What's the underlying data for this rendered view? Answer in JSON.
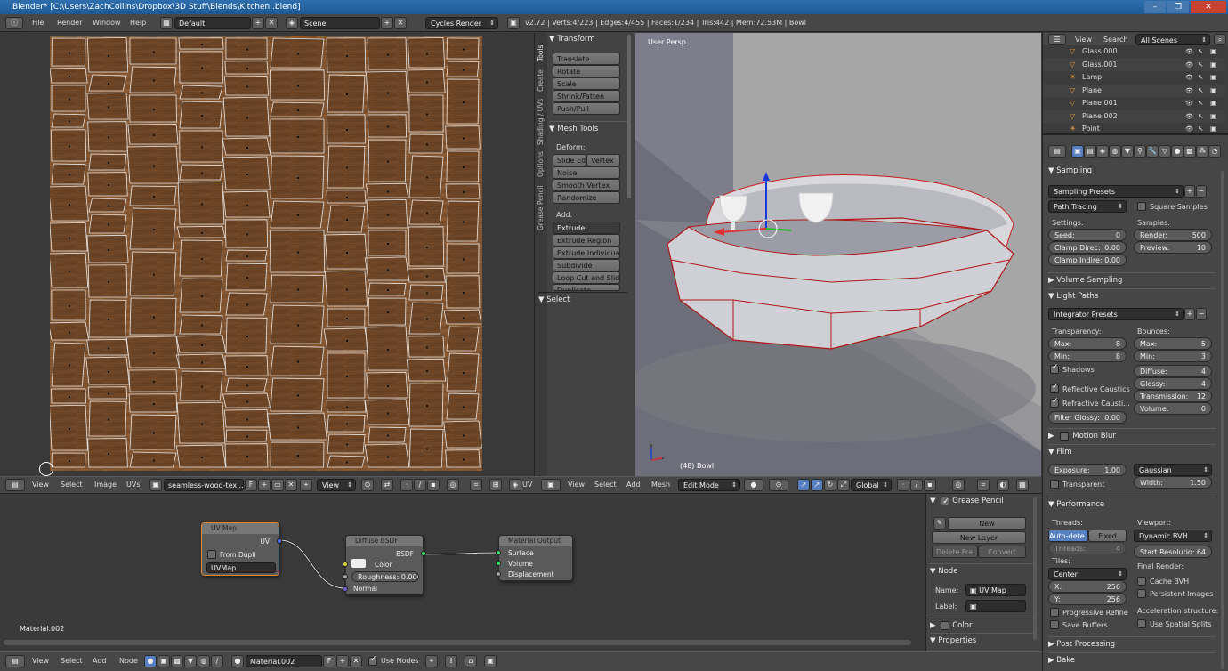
{
  "window": {
    "title": "Blender* [C:\\Users\\ZachCollins\\Dropbox\\3D Stuff\\Blends\\Kitchen .blend]"
  },
  "topbar": {
    "menu": [
      "File",
      "Render",
      "Window",
      "Help"
    ],
    "layout": "Default",
    "scene": "Scene",
    "engine": "Cycles Render",
    "stats": "v2.72 | Verts:4/223 | Edges:4/455 | Faces:1/234 | Tris:442 | Mem:72.53M | Bowl"
  },
  "uv_editor": {
    "header": {
      "view": "View",
      "select": "Select",
      "image": "Image",
      "uvs": "UVs",
      "image_name": "seamless-wood-tex...",
      "fake": "F",
      "view2": "View",
      "uv_label": "UV"
    }
  },
  "tool_shelf": {
    "tabs": [
      "Tools",
      "Create",
      "Shading / UVs",
      "Options",
      "Grease Pencil"
    ],
    "transform_title": "Transform",
    "transform": [
      "Translate",
      "Rotate",
      "Scale",
      "Shrink/Fatten",
      "Push/Pull"
    ],
    "mesh_tools_title": "Mesh Tools",
    "deform_label": "Deform:",
    "slide_edge": "Slide Ed",
    "vertex": "Vertex",
    "noise": "Noise",
    "smooth_vertex": "Smooth Vertex",
    "randomize": "Randomize",
    "add_label": "Add:",
    "extrude": "Extrude",
    "add": [
      "Extrude Region",
      "Extrude Individual",
      "Subdivide",
      "Loop Cut and Slide",
      "Duplicate"
    ],
    "select_title": "Select"
  },
  "viewport": {
    "label": "User Persp",
    "object_label": "(48) Bowl",
    "header": {
      "view": "View",
      "select": "Select",
      "add": "Add",
      "mesh": "Mesh",
      "mode": "Edit Mode",
      "orientation": "Global"
    }
  },
  "outliner": {
    "header": {
      "view": "View",
      "search": "Search",
      "scenes": "All Scenes"
    },
    "items": [
      "Glass.000",
      "Glass.001",
      "Lamp",
      "Plane",
      "Plane.001",
      "Plane.002",
      "Point"
    ]
  },
  "properties": {
    "sampling": {
      "title": "Sampling",
      "presets": "Sampling Presets",
      "integrator": "Path Tracing",
      "square_samples": "Square Samples",
      "settings_label": "Settings:",
      "samples_label": "Samples:",
      "seed_label": "Seed:",
      "seed": "0",
      "render_label": "Render:",
      "render": "500",
      "clamp_direct_label": "Clamp Direc:",
      "clamp_direct": "0.00",
      "preview_label": "Preview:",
      "preview": "10",
      "clamp_indirect_label": "Clamp Indire:",
      "clamp_indirect": "0.00"
    },
    "volume_sampling": "Volume Sampling",
    "light_paths": {
      "title": "Light Paths",
      "presets": "Integrator Presets",
      "transparency_label": "Transparency:",
      "bounces_label": "Bounces:",
      "t_max_label": "Max:",
      "t_max": "8",
      "t_min_label": "Min:",
      "t_min": "8",
      "b_max_label": "Max:",
      "b_max": "5",
      "b_min_label": "Min:",
      "b_min": "3",
      "shadows": "Shadows",
      "diffuse_label": "Diffuse:",
      "diffuse": "4",
      "glossy_label": "Glossy:",
      "glossy": "4",
      "reflective": "Reflective Caustics",
      "transmission_label": "Transmission:",
      "transmission": "12",
      "refractive": "Refractive Causti...",
      "volume_label": "Volume:",
      "volume": "0",
      "filter_glossy_label": "Filter Glossy:",
      "filter_glossy": "0.00"
    },
    "motion_blur": "Motion Blur",
    "film": {
      "title": "Film",
      "exposure_label": "Exposure:",
      "exposure": "1.00",
      "filter": "Gaussian",
      "transparent": "Transparent",
      "width_label": "Width:",
      "width": "1.50"
    },
    "performance": {
      "title": "Performance",
      "threads_label": "Threads:",
      "viewport_label": "Viewport:",
      "auto_detect": "Auto-dete...",
      "fixed": "Fixed",
      "viewport_bvh": "Dynamic BVH",
      "threads_field_label": "Threads:",
      "threads": "4",
      "start_res_label": "Start Resolutio:",
      "start_res": "64",
      "tiles_label": "Tiles:",
      "final_render_label": "Final Render:",
      "tile_order": "Center",
      "cache_bvh": "Cache BVH",
      "x_label": "X:",
      "x": "256",
      "persistent_images": "Persistent Images",
      "y_label": "Y:",
      "y": "256",
      "progressive_refine": "Progressive Refine",
      "acceleration_label": "Acceleration structure:",
      "save_buffers": "Save Buffers",
      "spatial_splits": "Use Spatial Splits"
    },
    "post_processing": "Post Processing",
    "bake": "Bake"
  },
  "node_editor": {
    "material_label": "Material.002",
    "nodes": {
      "uvmap": {
        "title": "UV Map",
        "out": "UV",
        "from_dupli": "From Dupli",
        "field": "UVMap"
      },
      "diffuse": {
        "title": "Diffuse BSDF",
        "out": "BSDF",
        "color": "Color",
        "roughness": "Roughness: 0.000",
        "normal": "Normal"
      },
      "output": {
        "title": "Material Output",
        "surface": "Surface",
        "volume": "Volume",
        "displacement": "Displacement"
      }
    },
    "sidebar": {
      "grease_pencil": "Grease Pencil",
      "new": "New",
      "new_layer": "New Layer",
      "delete_frame": "Delete Fra...",
      "convert": "Convert",
      "node_title": "Node",
      "name_label": "Name:",
      "name_value": "UV Map",
      "label_label": "Label:",
      "color": "Color",
      "properties": "Properties"
    },
    "header": {
      "view": "View",
      "select": "Select",
      "add": "Add",
      "node": "Node",
      "material": "Material.002",
      "fake": "F",
      "use_nodes": "Use Nodes"
    }
  },
  "colors": {
    "accent": "#5680c2",
    "selected_edge": "#e03030",
    "wood": "#8a5a35"
  }
}
